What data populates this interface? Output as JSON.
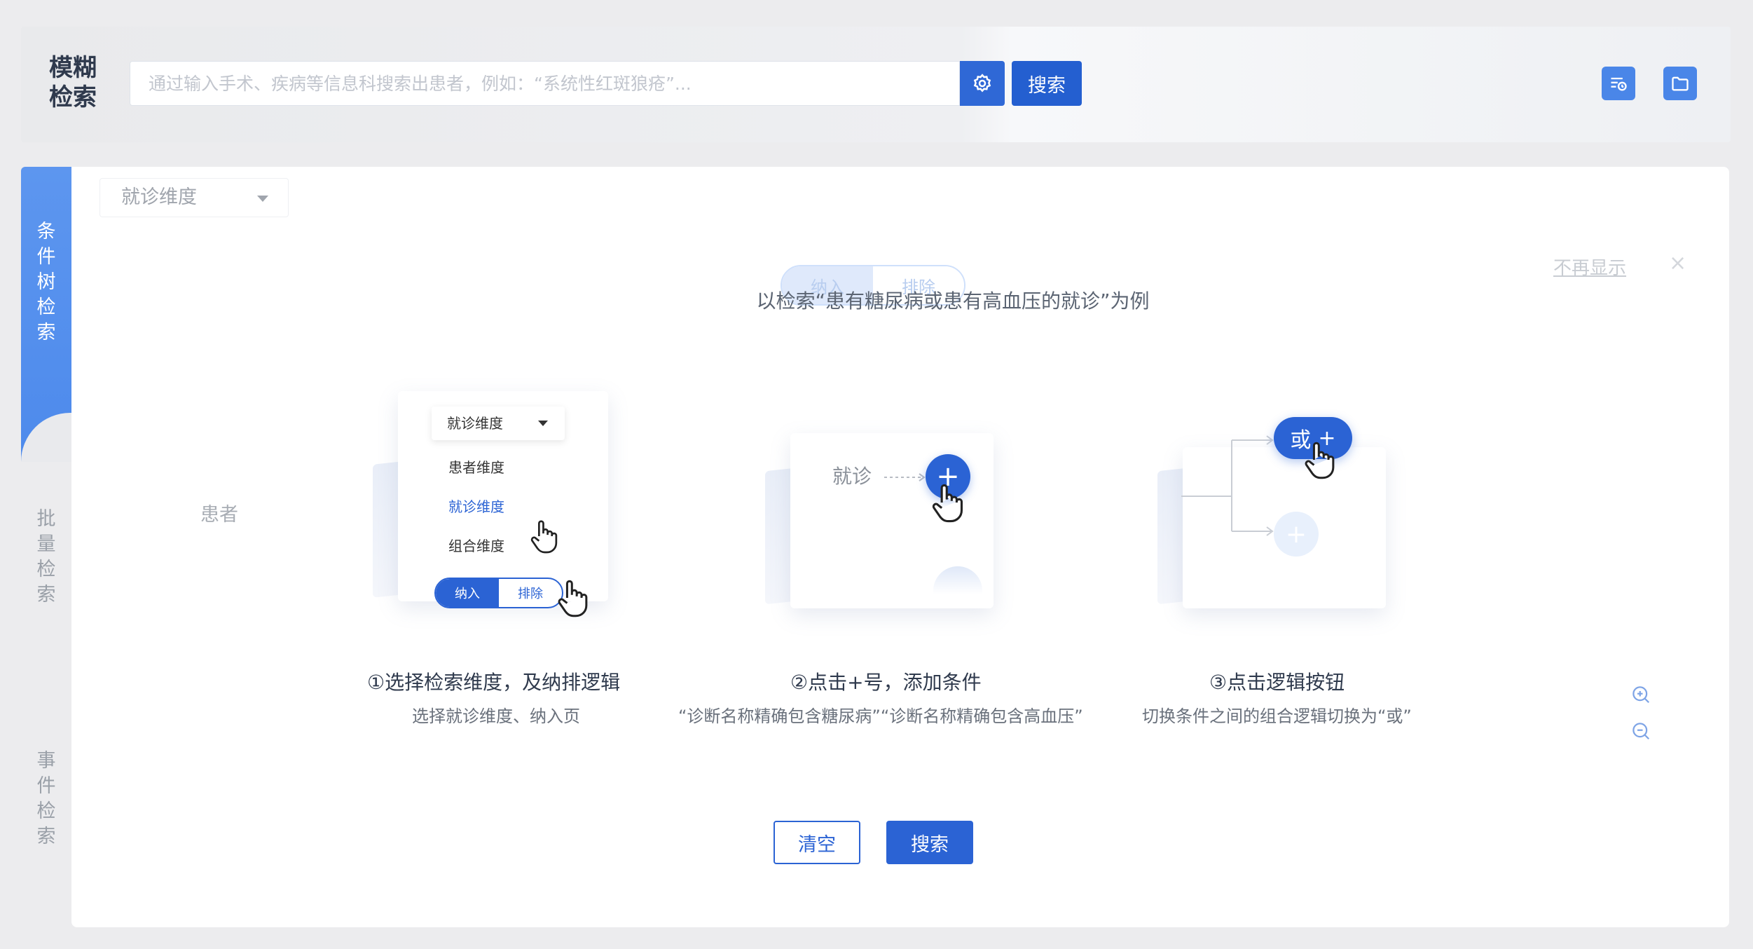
{
  "header": {
    "brand": "模糊检索",
    "search_placeholder": "通过输入手术、疾病等信息科搜索出患者，例如：“系统性红斑狼疮”...",
    "search_button": "搜索",
    "settings_icon": "gear-icon",
    "history_icon": "search-history-icon",
    "folder_icon": "folder-icon"
  },
  "side_tabs": [
    {
      "label": "条件树检索",
      "active": true
    },
    {
      "label": "批量检索",
      "active": false
    },
    {
      "label": "事件检索",
      "active": false
    }
  ],
  "main": {
    "dimension_select": "就诊维度",
    "root_node": "患者",
    "dont_show_again": "不再显示",
    "close": "×",
    "ghost_toggle": {
      "include": "纳入",
      "exclude": "排除"
    },
    "guide_title": "以检索“患有糖尿病或患有高血压的就诊”为例",
    "steps": [
      {
        "title": "①选择检索维度，及纳排逻辑",
        "desc": "选择就诊维度、纳入页",
        "select_value": "就诊维度",
        "menu": [
          "患者维度",
          "就诊维度",
          "组合维度"
        ],
        "toggle": {
          "include": "纳入",
          "exclude": "排除"
        }
      },
      {
        "title": "②点击+号，添加条件",
        "desc": "“诊断名称精确包含糖尿病”“诊断名称精确包含高血压”",
        "node_label": "就诊",
        "plus": "+"
      },
      {
        "title": "③点击逻辑按钮",
        "desc": "切换条件之间的组合逻辑切换为“或”",
        "or_label": "或",
        "plus": "+"
      }
    ],
    "zoom_in_icon": "zoom-in-icon",
    "zoom_out_icon": "zoom-out-icon",
    "clear_button": "清空",
    "search_button": "搜索"
  },
  "colors": {
    "primary": "#2b63d4",
    "side_active": "#4d8aec",
    "page_bg": "#ececee"
  }
}
